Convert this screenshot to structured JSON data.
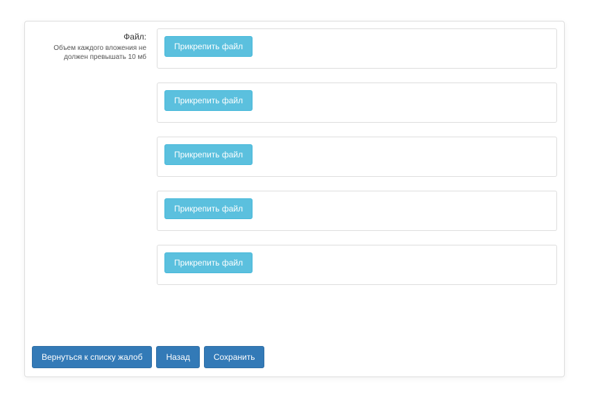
{
  "form": {
    "file_label": "Файл:",
    "file_hint": "Объем каждого вложения не должен превышать 10 мб",
    "attach_slots": [
      {
        "button_label": "Прикрепить файл"
      },
      {
        "button_label": "Прикрепить файл"
      },
      {
        "button_label": "Прикрепить файл"
      },
      {
        "button_label": "Прикрепить файл"
      },
      {
        "button_label": "Прикрепить файл"
      }
    ]
  },
  "footer": {
    "back_to_list_label": "Вернуться к списку жалоб",
    "back_label": "Назад",
    "save_label": "Сохранить"
  }
}
